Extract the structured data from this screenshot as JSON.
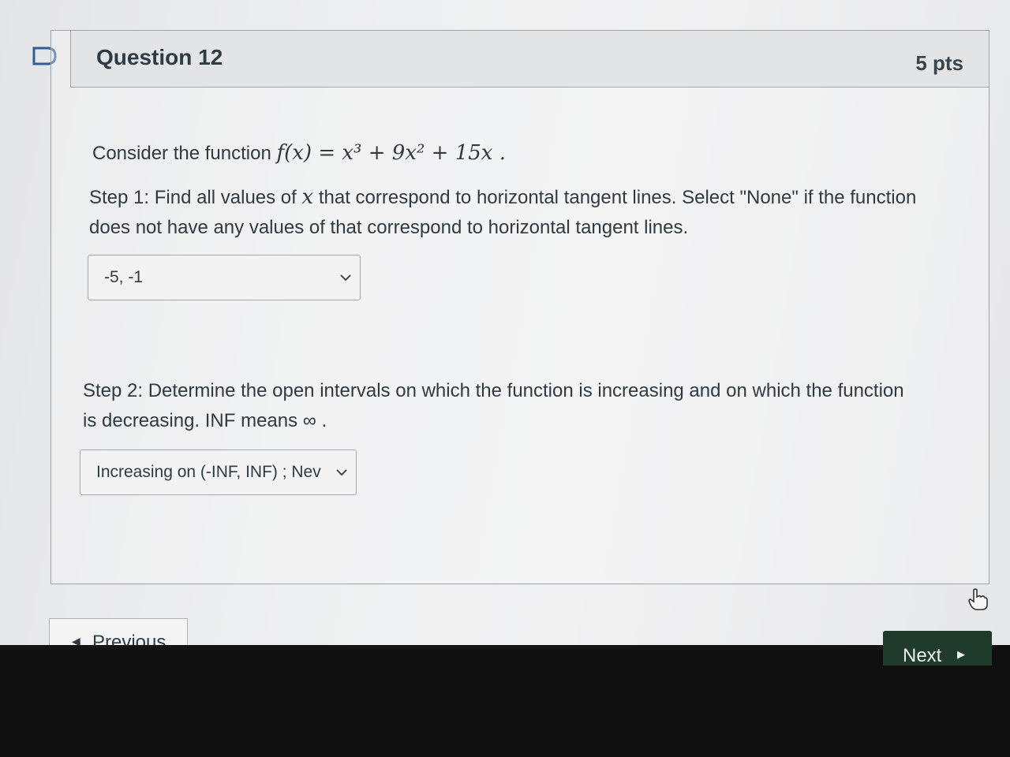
{
  "question": {
    "title": "Question 12",
    "points": "5 pts"
  },
  "prompt": {
    "lead": "Consider the function ",
    "function": "f(x) = x³ + 9x² + 15x ."
  },
  "step1": {
    "text_a": "Step 1:  Find all values of ",
    "var": "x",
    "text_b": "  that correspond to horizontal tangent lines.  Select \"None\" if the function does not have any values of  that correspond to horizontal tangent lines.",
    "selected": "-5, -1"
  },
  "step2": {
    "text": "Step 2:  Determine the open intervals on which the function is increasing and on which the function is decreasing.  INF means ∞ .",
    "selected": "Increasing on (-INF, INF) ; Nev"
  },
  "nav": {
    "previous_label": "Previous",
    "next_label": "Next"
  },
  "icons": {
    "flag": "flag-icon",
    "chevron": "chevron-down-icon",
    "prev_arrow": "triangle-left-icon",
    "next_arrow": "triangle-right-icon",
    "cursor": "hand-cursor-icon"
  },
  "colors": {
    "next_button": "#1e3b2c",
    "text": "#2d3b45"
  }
}
